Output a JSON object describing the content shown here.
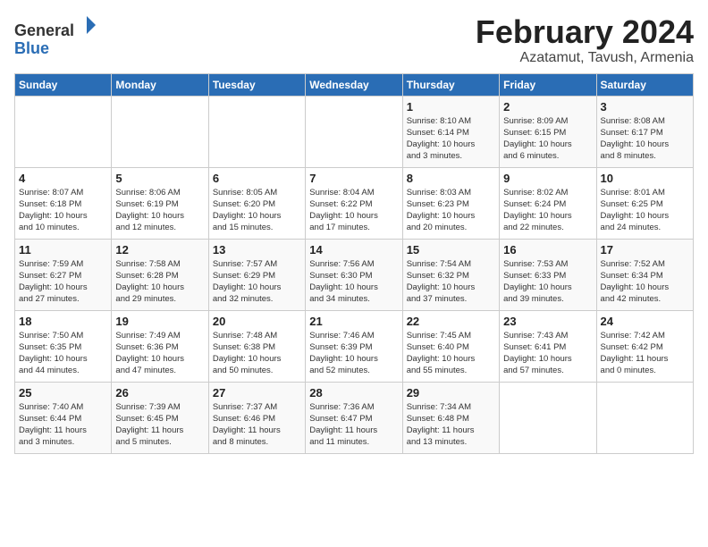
{
  "logo": {
    "general": "General",
    "blue": "Blue"
  },
  "header": {
    "title": "February 2024",
    "subtitle": "Azatamut, Tavush, Armenia"
  },
  "weekdays": [
    "Sunday",
    "Monday",
    "Tuesday",
    "Wednesday",
    "Thursday",
    "Friday",
    "Saturday"
  ],
  "weeks": [
    [
      {
        "day": "",
        "info": ""
      },
      {
        "day": "",
        "info": ""
      },
      {
        "day": "",
        "info": ""
      },
      {
        "day": "",
        "info": ""
      },
      {
        "day": "1",
        "info": "Sunrise: 8:10 AM\nSunset: 6:14 PM\nDaylight: 10 hours\nand 3 minutes."
      },
      {
        "day": "2",
        "info": "Sunrise: 8:09 AM\nSunset: 6:15 PM\nDaylight: 10 hours\nand 6 minutes."
      },
      {
        "day": "3",
        "info": "Sunrise: 8:08 AM\nSunset: 6:17 PM\nDaylight: 10 hours\nand 8 minutes."
      }
    ],
    [
      {
        "day": "4",
        "info": "Sunrise: 8:07 AM\nSunset: 6:18 PM\nDaylight: 10 hours\nand 10 minutes."
      },
      {
        "day": "5",
        "info": "Sunrise: 8:06 AM\nSunset: 6:19 PM\nDaylight: 10 hours\nand 12 minutes."
      },
      {
        "day": "6",
        "info": "Sunrise: 8:05 AM\nSunset: 6:20 PM\nDaylight: 10 hours\nand 15 minutes."
      },
      {
        "day": "7",
        "info": "Sunrise: 8:04 AM\nSunset: 6:22 PM\nDaylight: 10 hours\nand 17 minutes."
      },
      {
        "day": "8",
        "info": "Sunrise: 8:03 AM\nSunset: 6:23 PM\nDaylight: 10 hours\nand 20 minutes."
      },
      {
        "day": "9",
        "info": "Sunrise: 8:02 AM\nSunset: 6:24 PM\nDaylight: 10 hours\nand 22 minutes."
      },
      {
        "day": "10",
        "info": "Sunrise: 8:01 AM\nSunset: 6:25 PM\nDaylight: 10 hours\nand 24 minutes."
      }
    ],
    [
      {
        "day": "11",
        "info": "Sunrise: 7:59 AM\nSunset: 6:27 PM\nDaylight: 10 hours\nand 27 minutes."
      },
      {
        "day": "12",
        "info": "Sunrise: 7:58 AM\nSunset: 6:28 PM\nDaylight: 10 hours\nand 29 minutes."
      },
      {
        "day": "13",
        "info": "Sunrise: 7:57 AM\nSunset: 6:29 PM\nDaylight: 10 hours\nand 32 minutes."
      },
      {
        "day": "14",
        "info": "Sunrise: 7:56 AM\nSunset: 6:30 PM\nDaylight: 10 hours\nand 34 minutes."
      },
      {
        "day": "15",
        "info": "Sunrise: 7:54 AM\nSunset: 6:32 PM\nDaylight: 10 hours\nand 37 minutes."
      },
      {
        "day": "16",
        "info": "Sunrise: 7:53 AM\nSunset: 6:33 PM\nDaylight: 10 hours\nand 39 minutes."
      },
      {
        "day": "17",
        "info": "Sunrise: 7:52 AM\nSunset: 6:34 PM\nDaylight: 10 hours\nand 42 minutes."
      }
    ],
    [
      {
        "day": "18",
        "info": "Sunrise: 7:50 AM\nSunset: 6:35 PM\nDaylight: 10 hours\nand 44 minutes."
      },
      {
        "day": "19",
        "info": "Sunrise: 7:49 AM\nSunset: 6:36 PM\nDaylight: 10 hours\nand 47 minutes."
      },
      {
        "day": "20",
        "info": "Sunrise: 7:48 AM\nSunset: 6:38 PM\nDaylight: 10 hours\nand 50 minutes."
      },
      {
        "day": "21",
        "info": "Sunrise: 7:46 AM\nSunset: 6:39 PM\nDaylight: 10 hours\nand 52 minutes."
      },
      {
        "day": "22",
        "info": "Sunrise: 7:45 AM\nSunset: 6:40 PM\nDaylight: 10 hours\nand 55 minutes."
      },
      {
        "day": "23",
        "info": "Sunrise: 7:43 AM\nSunset: 6:41 PM\nDaylight: 10 hours\nand 57 minutes."
      },
      {
        "day": "24",
        "info": "Sunrise: 7:42 AM\nSunset: 6:42 PM\nDaylight: 11 hours\nand 0 minutes."
      }
    ],
    [
      {
        "day": "25",
        "info": "Sunrise: 7:40 AM\nSunset: 6:44 PM\nDaylight: 11 hours\nand 3 minutes."
      },
      {
        "day": "26",
        "info": "Sunrise: 7:39 AM\nSunset: 6:45 PM\nDaylight: 11 hours\nand 5 minutes."
      },
      {
        "day": "27",
        "info": "Sunrise: 7:37 AM\nSunset: 6:46 PM\nDaylight: 11 hours\nand 8 minutes."
      },
      {
        "day": "28",
        "info": "Sunrise: 7:36 AM\nSunset: 6:47 PM\nDaylight: 11 hours\nand 11 minutes."
      },
      {
        "day": "29",
        "info": "Sunrise: 7:34 AM\nSunset: 6:48 PM\nDaylight: 11 hours\nand 13 minutes."
      },
      {
        "day": "",
        "info": ""
      },
      {
        "day": "",
        "info": ""
      }
    ]
  ]
}
